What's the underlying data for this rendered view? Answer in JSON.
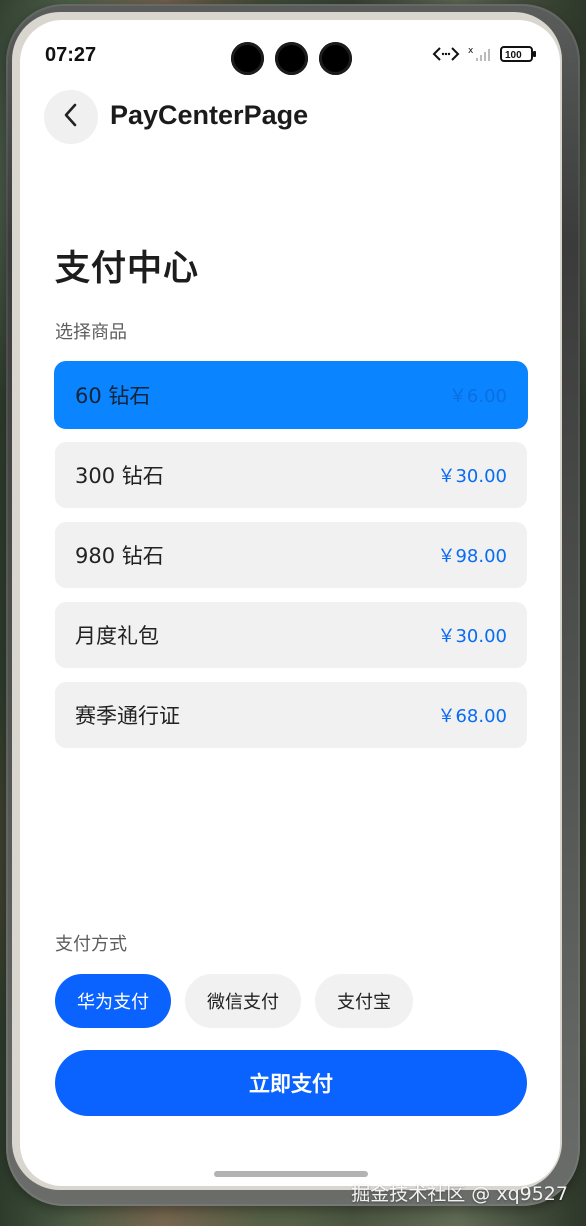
{
  "status_bar": {
    "time": "07:27",
    "battery": "100"
  },
  "header": {
    "title": "PayCenterPage"
  },
  "main": {
    "title": "支付中心",
    "products_label": "选择商品",
    "products": [
      {
        "name": "60 钻石",
        "price": "￥6.00",
        "selected": true
      },
      {
        "name": "300 钻石",
        "price": "￥30.00",
        "selected": false
      },
      {
        "name": "980 钻石",
        "price": "￥98.00",
        "selected": false
      },
      {
        "name": "月度礼包",
        "price": "￥30.00",
        "selected": false
      },
      {
        "name": "赛季通行证",
        "price": "￥68.00",
        "selected": false
      }
    ],
    "payment_label": "支付方式",
    "payment_methods": [
      {
        "label": "华为支付",
        "selected": true
      },
      {
        "label": "微信支付",
        "selected": false
      },
      {
        "label": "支付宝",
        "selected": false
      }
    ],
    "pay_button": "立即支付"
  },
  "footer": {
    "watermark": "掘金技术社区 @ xq9527"
  },
  "icons": {
    "back": "chevron-left-icon",
    "code": "code-icon",
    "signal": "signal-icon",
    "battery": "battery-icon"
  },
  "colors": {
    "accent": "#0a63ff",
    "selected_item": "#0a84ff",
    "surface": "#f1f1f1",
    "text": "#222222"
  }
}
